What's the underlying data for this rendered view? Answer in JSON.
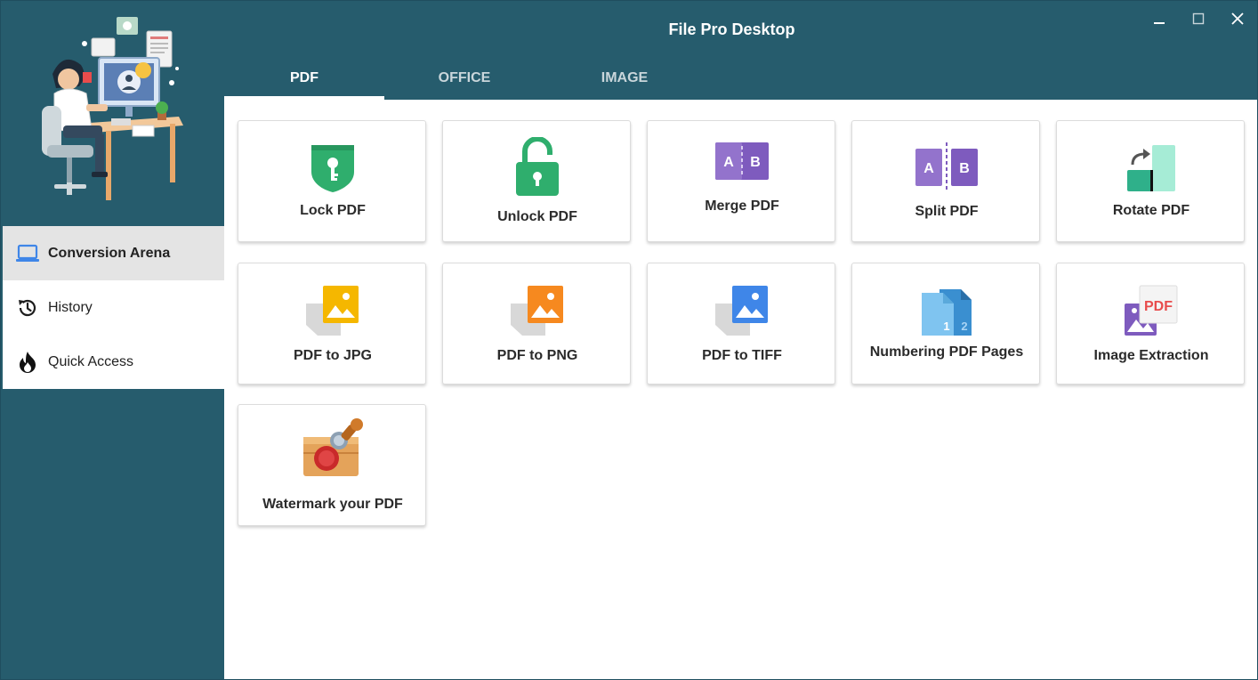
{
  "window": {
    "title": "File Pro Desktop"
  },
  "tabs": [
    {
      "label": "PDF",
      "active": true
    },
    {
      "label": "OFFICE",
      "active": false
    },
    {
      "label": "IMAGE",
      "active": false
    }
  ],
  "sidebar": {
    "items": [
      {
        "label": "Conversion Arena",
        "icon": "laptop-icon",
        "active": true
      },
      {
        "label": "History",
        "icon": "history-icon",
        "active": false
      },
      {
        "label": "Quick Access",
        "icon": "flame-icon",
        "active": false
      }
    ]
  },
  "tools": [
    {
      "label": "Lock PDF",
      "icon": "lock-shield-icon"
    },
    {
      "label": "Unlock PDF",
      "icon": "unlock-icon"
    },
    {
      "label": "Merge PDF",
      "icon": "merge-icon"
    },
    {
      "label": "Split PDF",
      "icon": "split-icon"
    },
    {
      "label": "Rotate PDF",
      "icon": "rotate-icon"
    },
    {
      "label": "PDF to JPG",
      "icon": "jpg-image-icon"
    },
    {
      "label": "PDF to PNG",
      "icon": "png-image-icon"
    },
    {
      "label": "PDF to TIFF",
      "icon": "tiff-image-icon"
    },
    {
      "label": "Numbering PDF Pages",
      "icon": "page-numbering-icon"
    },
    {
      "label": "Image Extraction",
      "icon": "image-extraction-icon"
    },
    {
      "label": "Watermark your PDF",
      "icon": "stamp-seal-icon"
    }
  ],
  "icon_text": {
    "merge_a": "A",
    "merge_b": "B",
    "split_a": "A",
    "split_b": "B",
    "num_1": "1",
    "num_2": "2",
    "extract_pdf": "PDF"
  },
  "colors": {
    "header_bg": "#265c6d",
    "sidebar_bg": "#265c6d",
    "active_nav_bg": "#e4e4e4",
    "lock_green": "#2fae6d",
    "merge_purple": "#7e5bbe",
    "jpg_yellow": "#f5b700",
    "png_orange": "#f6891f",
    "tiff_blue": "#3f86e8"
  }
}
